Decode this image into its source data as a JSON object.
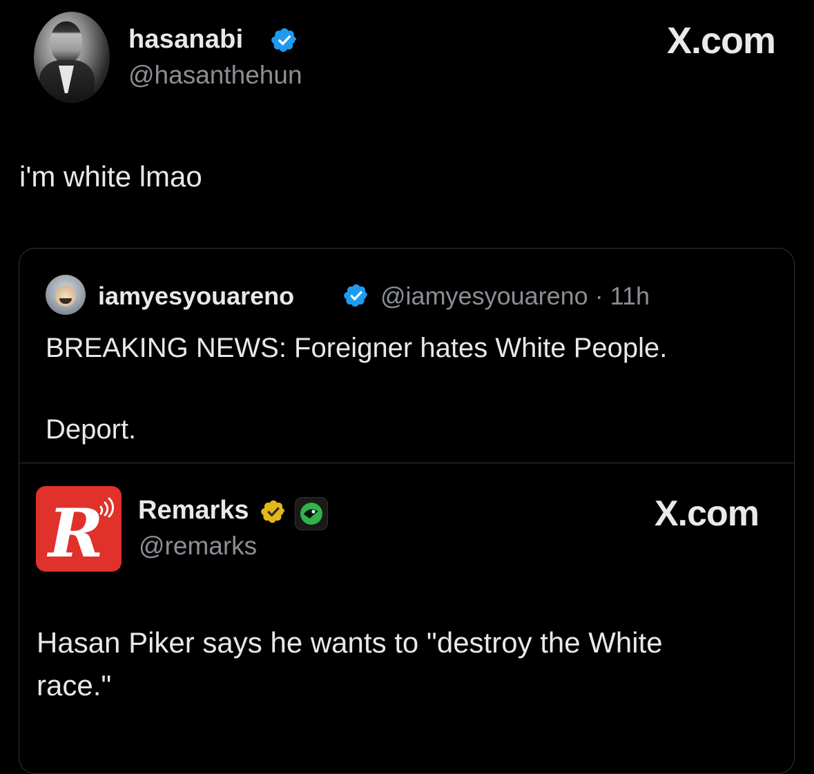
{
  "main_tweet": {
    "display_name": "hasanabi",
    "handle": "@hasanthehun",
    "site_label": "X.com",
    "text": "i'm white lmao"
  },
  "quoted_tweet": {
    "display_name": "iamyesyouareno",
    "handle_time": "@iamyesyouareno · 11h",
    "line1": "BREAKING NEWS: Foreigner hates White People.",
    "line2": "Deport."
  },
  "embedded_tweet": {
    "display_name": "Remarks",
    "handle": "@remarks",
    "logo_letter": "R",
    "site_label": "X.com",
    "text_line1": "Hasan Piker says he wants to \"destroy the White",
    "text_line2": "race.\""
  },
  "colors": {
    "background": "#000000",
    "text_primary": "#e7e9ea",
    "text_secondary": "#8b8f94",
    "verified_blue": "#1d9bf0",
    "verified_gold": "#e2b719",
    "border": "#2f3336",
    "remarks_red": "#e0312b"
  },
  "icons": [
    "verified-badge-icon",
    "gold-verified-badge-icon",
    "affiliate-badge-icon"
  ]
}
